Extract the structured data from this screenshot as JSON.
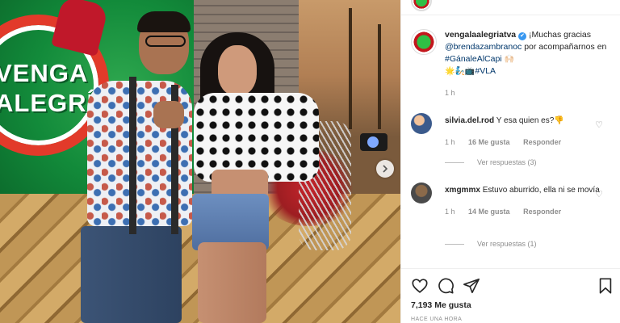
{
  "post_image": {
    "logo_line1": "VENGA",
    "logo_line2": "ALEGRÍA"
  },
  "caption": {
    "username": "vengalaalegriatva",
    "verified_badge": "✔",
    "text_intro": "¡Muchas gracias",
    "mention": "@brendazambranoc",
    "text_mid": "por acompañarnos en",
    "hashtag1": "#GánaleAlCapi",
    "emoji1": "🙌🏻",
    "emoji2": "🌟🧞📺",
    "hashtag2": "#VLA",
    "age": "1 h"
  },
  "comments": [
    {
      "username": "silvia.del.rod",
      "text": "Y esa quien es?👎",
      "age": "1 h",
      "likes": "16 Me gusta",
      "reply_label": "Responder",
      "view_replies": "Ver respuestas (3)"
    },
    {
      "username": "xmgmmx",
      "text": "Estuvo aburrido, ella ni se movía",
      "age": "1 h",
      "likes": "14 Me gusta",
      "reply_label": "Responder",
      "view_replies": "Ver respuestas (1)"
    }
  ],
  "likes_count": "7,193 Me gusta",
  "timestamp": "HACE UNA HORA",
  "icons": {
    "like": "heart-icon",
    "comment": "comment-bubble-icon",
    "share": "paper-plane-icon",
    "save": "bookmark-icon",
    "next": "chevron-right-icon"
  },
  "colors": {
    "link": "#00376b",
    "muted": "#8e8e8e",
    "verified": "#3897f0"
  }
}
